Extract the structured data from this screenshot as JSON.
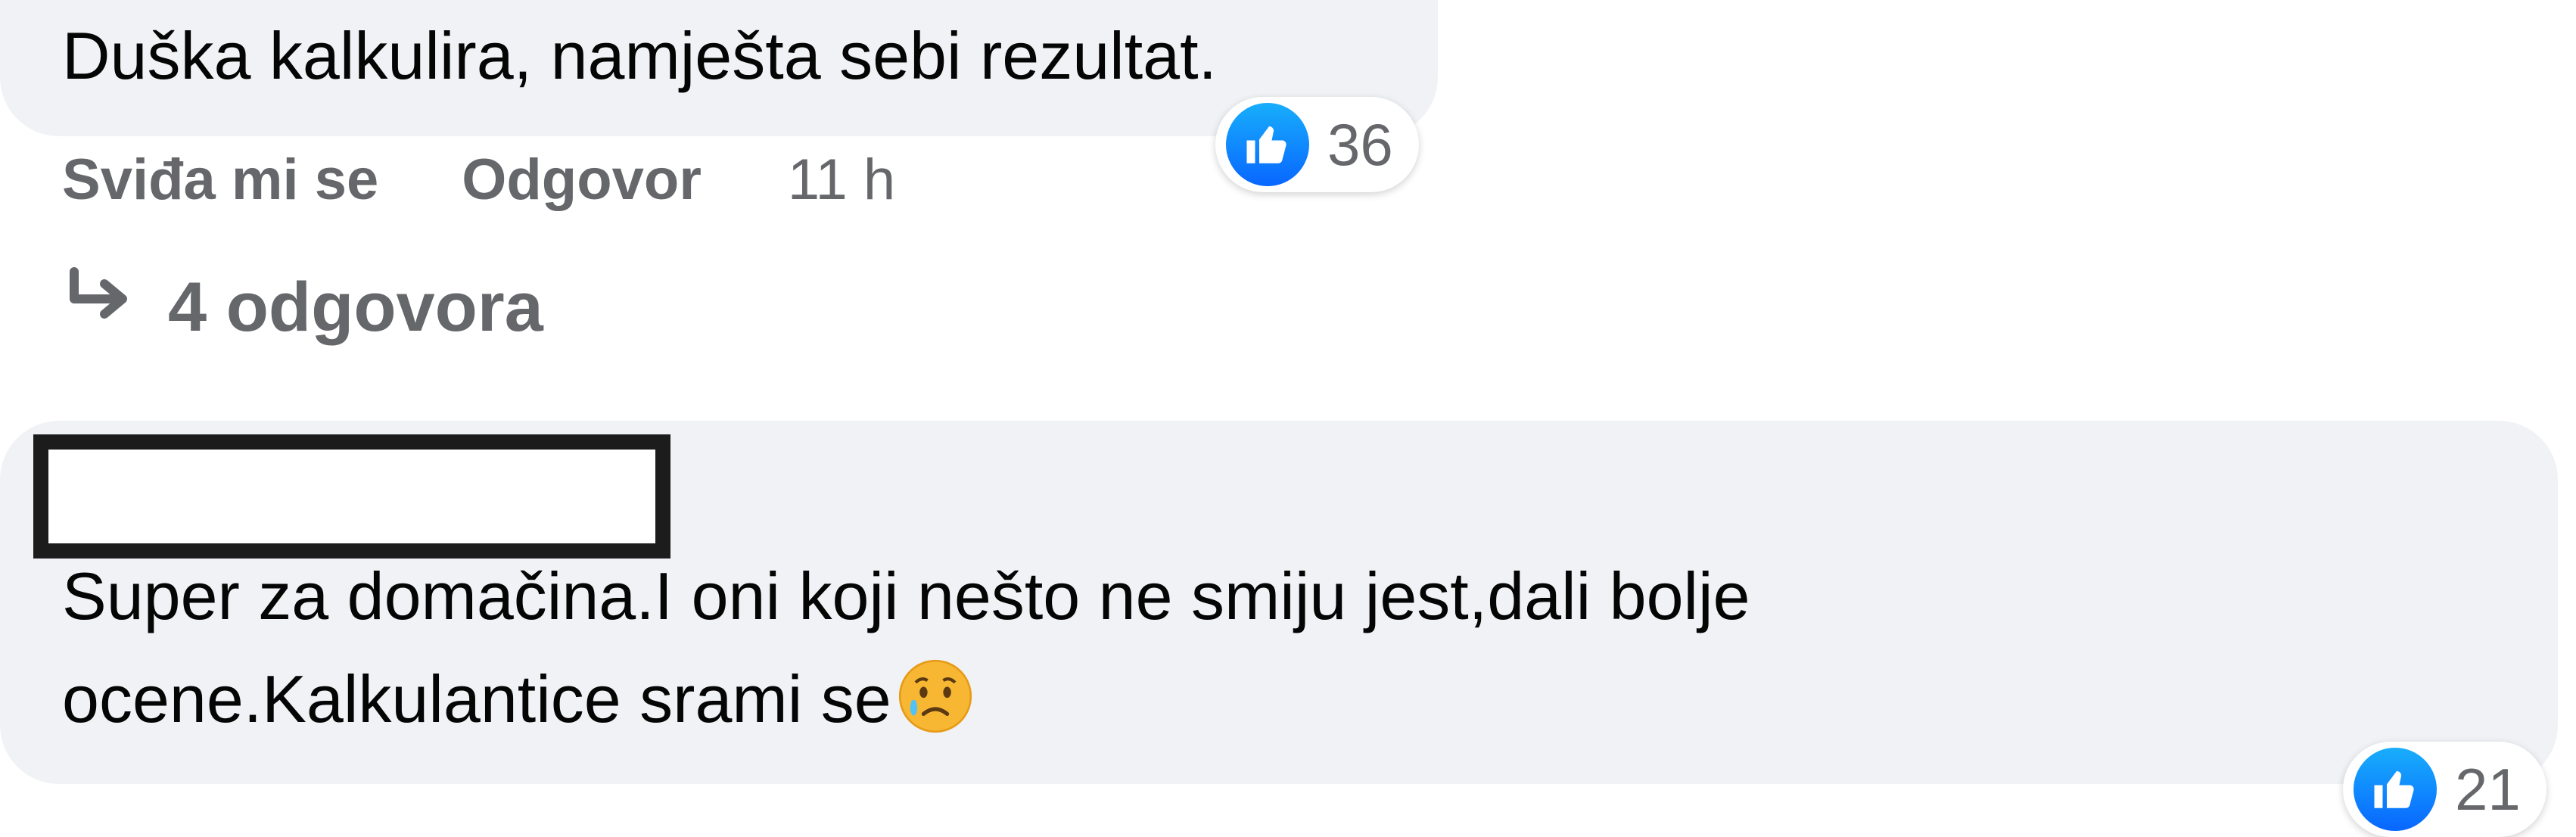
{
  "comment1": {
    "text": "Duška kalkulira, namješta sebi rezultat.",
    "reaction_count": "36",
    "actions": {
      "like": "Sviđa mi se",
      "reply": "Odgovor",
      "time": "11 h"
    },
    "replies_label": "4 odgovora"
  },
  "comment2": {
    "author_redacted": true,
    "line1": "Super za domačina.I oni koji nešto ne smiju jest,dali bolje",
    "line2": "ocene.Kalkulantice srami se",
    "emoji": "sad-but-relieved-face",
    "reaction_count": "21"
  },
  "colors": {
    "bubble": "#f0f2f5",
    "secondary_text": "#65676b",
    "like_blue": "#0866ff"
  }
}
